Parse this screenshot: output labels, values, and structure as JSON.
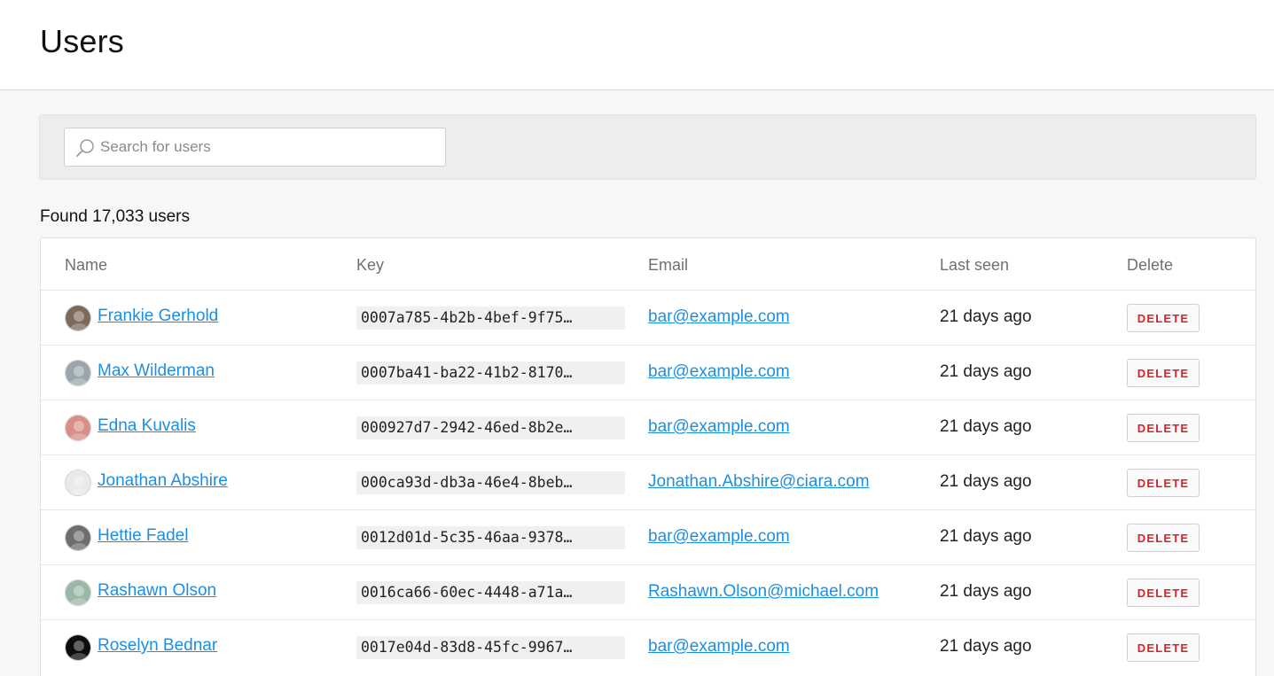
{
  "page": {
    "title": "Users"
  },
  "search": {
    "placeholder": "Search for users",
    "value": ""
  },
  "results": {
    "found_text": "Found 17,033 users"
  },
  "table": {
    "columns": [
      "Name",
      "Key",
      "Email",
      "Last seen",
      "Delete"
    ],
    "rows": [
      {
        "name": "Frankie Gerhold",
        "key": "0007a785-4b2b-4bef-9f75…",
        "email": "bar@example.com",
        "last_seen": "21 days ago",
        "delete_label": "DELETE",
        "avatar_color": "#7b6a5c"
      },
      {
        "name": "Max Wilderman",
        "key": "0007ba41-ba22-41b2-8170…",
        "email": "bar@example.com",
        "last_seen": "21 days ago",
        "delete_label": "DELETE",
        "avatar_color": "#9aa6ad"
      },
      {
        "name": "Edna Kuvalis",
        "key": "000927d7-2942-46ed-8b2e…",
        "email": "bar@example.com",
        "last_seen": "21 days ago",
        "delete_label": "DELETE",
        "avatar_color": "#d98e86"
      },
      {
        "name": "Jonathan Abshire",
        "key": "000ca93d-db3a-46e4-8beb…",
        "email": "Jonathan.Abshire@ciara.com",
        "last_seen": "21 days ago",
        "delete_label": "DELETE",
        "avatar_color": "#e9e9e9"
      },
      {
        "name": "Hettie Fadel",
        "key": "0012d01d-5c35-46aa-9378…",
        "email": "bar@example.com",
        "last_seen": "21 days ago",
        "delete_label": "DELETE",
        "avatar_color": "#6e6e6e"
      },
      {
        "name": "Rashawn Olson",
        "key": "0016ca66-60ec-4448-a71a…",
        "email": "Rashawn.Olson@michael.com",
        "last_seen": "21 days ago",
        "delete_label": "DELETE",
        "avatar_color": "#9bb7a6"
      },
      {
        "name": "Roselyn Bednar",
        "key": "0017e04d-83d8-45fc-9967…",
        "email": "bar@example.com",
        "last_seen": "21 days ago",
        "delete_label": "DELETE",
        "avatar_color": "#0d0d0d"
      }
    ]
  },
  "colors": {
    "link": "#1a8fe3",
    "delete_text": "#d6232b"
  }
}
